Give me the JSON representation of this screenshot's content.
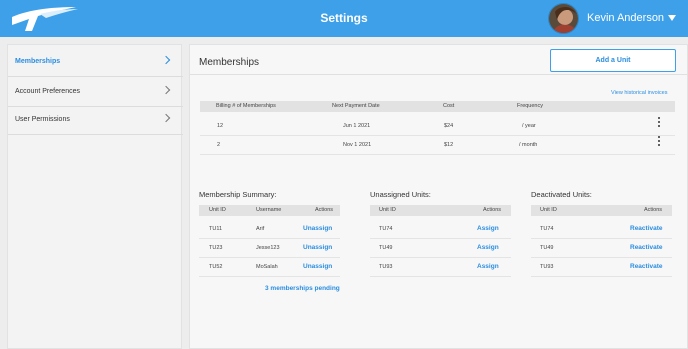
{
  "header": {
    "title": "Settings",
    "user_name": "Kevin Anderson",
    "accent": "#3ea0e8"
  },
  "sidebar": {
    "items": [
      {
        "label": "Memberships",
        "active": true
      },
      {
        "label": "Account Preferences",
        "active": false
      },
      {
        "label": "User Permissions",
        "active": false
      }
    ]
  },
  "main": {
    "title": "Memberships",
    "add_button": "Add a Unit",
    "history_link": "View historical invoices",
    "columns": [
      "Billing # of Memberships",
      "Next Payment Date",
      "Cost",
      "Frequency"
    ],
    "rows": [
      {
        "count": "12",
        "date": "Jun 1 2021",
        "cost": "$24",
        "frequency": "/ year"
      },
      {
        "count": "2",
        "date": "Nov 1 2021",
        "cost": "$12",
        "frequency": "/ month"
      }
    ]
  },
  "summary": {
    "title": "Membership Summary:",
    "columns": [
      "Unit ID",
      "Username",
      "Actions"
    ],
    "rows": [
      {
        "unit": "TU11",
        "user": "Arif",
        "action": "Unassign"
      },
      {
        "unit": "TU23",
        "user": "Jesse123",
        "action": "Unassign"
      },
      {
        "unit": "TU52",
        "user": "MoSalah",
        "action": "Unassign"
      }
    ],
    "pending": "3 memberships pending"
  },
  "unassigned": {
    "title": "Unassigned Units:",
    "columns": [
      "Unit ID",
      "Actions"
    ],
    "rows": [
      {
        "unit": "TU74",
        "action": "Assign"
      },
      {
        "unit": "TU49",
        "action": "Assign"
      },
      {
        "unit": "TU93",
        "action": "Assign"
      }
    ]
  },
  "deactivated": {
    "title": "Deactivated Units:",
    "columns": [
      "Unit ID",
      "Actions"
    ],
    "rows": [
      {
        "unit": "TU74",
        "action": "Reactivate"
      },
      {
        "unit": "TU49",
        "action": "Reactivate"
      },
      {
        "unit": "TU93",
        "action": "Reactivate"
      }
    ]
  },
  "icons": {
    "logo": "brand-logo-icon",
    "chevron": "chevron-right-icon",
    "caret": "caret-down-icon",
    "kebab": "more-vertical-icon"
  }
}
